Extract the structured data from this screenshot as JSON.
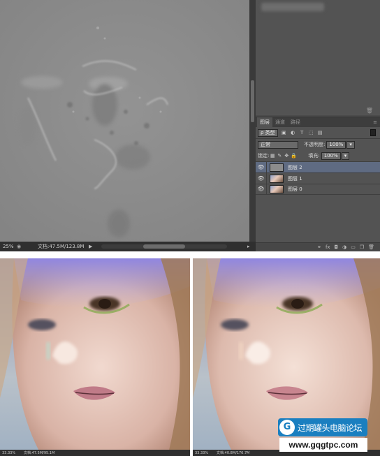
{
  "canvas_status": {
    "zoom": "25%",
    "doc": "文档:47.5M/123.8M"
  },
  "layers_panel": {
    "tabs": [
      "图层",
      "通道",
      "路径"
    ],
    "menu_icon": "menu-icon",
    "kind_filter": "ρ 类型",
    "blend_mode": "正常",
    "opacity_label": "不透明度:",
    "opacity_value": "100%",
    "lock_label": "锁定:",
    "fill_label": "填充:",
    "fill_value": "100%",
    "layers": [
      {
        "name": "图层 2",
        "visible": true,
        "selected": true
      },
      {
        "name": "图层 1",
        "visible": true,
        "selected": false
      },
      {
        "name": "图层 0",
        "visible": true,
        "selected": false
      }
    ],
    "bottom_icons": [
      "link-icon",
      "fx-icon",
      "mask-icon",
      "adjustment-icon",
      "group-icon",
      "new-layer-icon",
      "trash-icon"
    ]
  },
  "photo_left": {
    "zoom": "33.33%",
    "doc": "文档:47.5M/95.1M"
  },
  "photo_right": {
    "zoom": "33.33%",
    "doc": "文档:40.8M/176.7M"
  },
  "watermark": {
    "title": "过期罐头电脑论坛",
    "url": "www.gqgtpc.com"
  },
  "colors": {
    "selected_layer": "#5f6b82",
    "panel_bg": "#535353",
    "canvas_gray": "#8c8c8c",
    "watermark_blue": "#1a7fc0"
  }
}
